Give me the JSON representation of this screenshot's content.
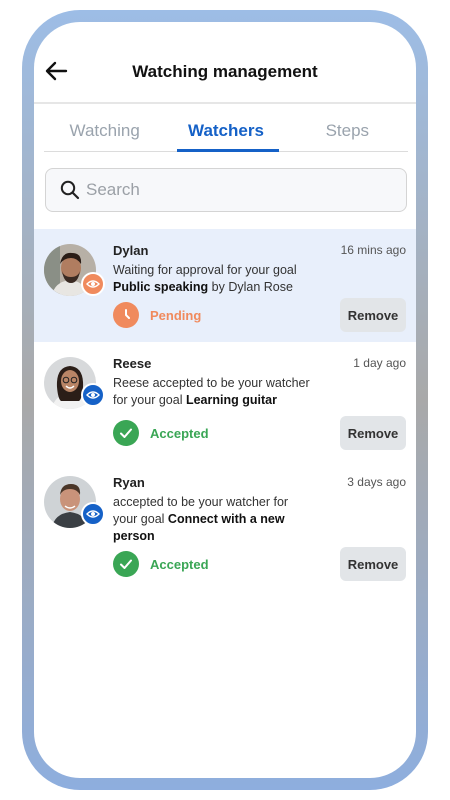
{
  "header": {
    "title": "Watching management",
    "back_icon": "arrow-left-icon"
  },
  "tabs": [
    {
      "label": "Watching",
      "active": false
    },
    {
      "label": "Watchers",
      "active": true
    },
    {
      "label": "Steps",
      "active": false
    }
  ],
  "search": {
    "placeholder": "Search",
    "value": "",
    "icon": "search-icon"
  },
  "colors": {
    "accent": "#1561c7",
    "pending": "#f08a5d",
    "accepted": "#3aa655",
    "highlight_bg": "#e8effb"
  },
  "watchers": [
    {
      "name": "Dylan",
      "time": "16 mins ago",
      "message_prefix": "Waiting for approval for your goal",
      "goal": "Public speaking",
      "message_suffix": "by Dylan Rose",
      "status": "Pending",
      "remove_label": "Remove"
    },
    {
      "name": "Reese",
      "time": "1 day ago",
      "message_prefix": "Reese accepted to be your watcher for your goal",
      "goal": "Learning guitar",
      "message_suffix": "",
      "status": "Accepted",
      "remove_label": "Remove"
    },
    {
      "name": "Ryan",
      "time": "3 days ago",
      "message_prefix": "accepted to be your watcher for your goal",
      "goal": "Connect with a new person",
      "message_suffix": "",
      "status": "Accepted",
      "remove_label": "Remove"
    }
  ]
}
